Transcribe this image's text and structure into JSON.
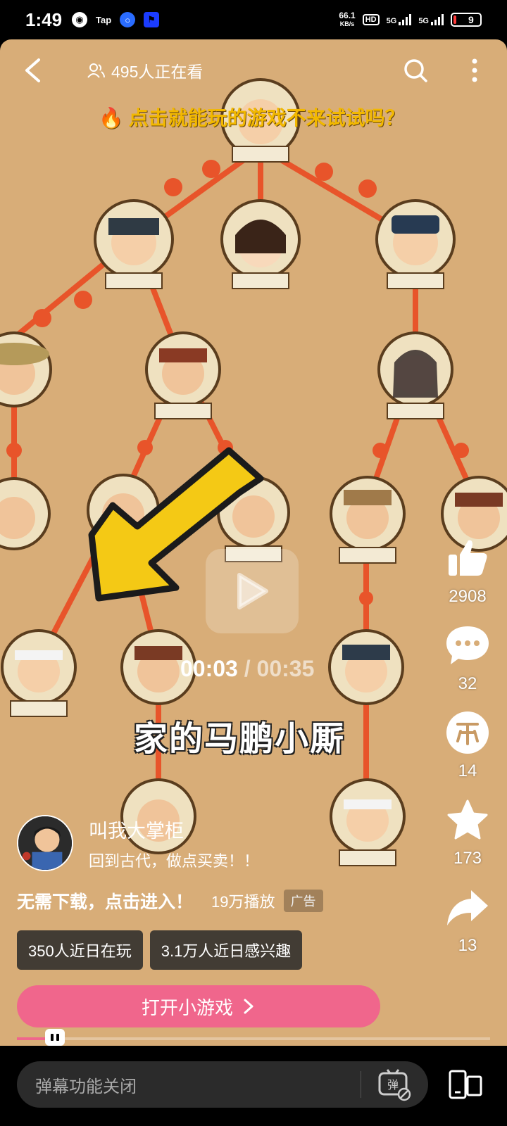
{
  "status_bar": {
    "time": "1:49",
    "net_speed_value": "66.1",
    "net_speed_unit": "KB/s",
    "hd_label": "HD",
    "signal1_label": "5G",
    "signal2_label": "5G",
    "battery_level": "9",
    "app_icons": [
      "location-icon",
      "tap-icon",
      "blue-circle-icon",
      "race-icon"
    ]
  },
  "top_bar": {
    "viewer_count_text": "495人正在看"
  },
  "video": {
    "title": "点击就能玩的游戏不来试试吗？",
    "current_time": "00:03",
    "total_time": "/ 00:35",
    "subtitle": "家的马鹏小厮",
    "progress_fraction": 0.086
  },
  "actions": {
    "like_count": "2908",
    "comment_count": "32",
    "coin_count": "14",
    "favorite_count": "173",
    "share_count": "13"
  },
  "author": {
    "name": "叫我大掌柜",
    "description": "回到古代，做点买卖！！"
  },
  "promo": {
    "cta_text": "无需下载，点击进入！",
    "plays": "19万播放",
    "ad_label": "广告",
    "chips": [
      "350人近日在玩",
      "3.1万人近日感兴趣"
    ],
    "open_button": "打开小游戏"
  },
  "bottom": {
    "danmu_placeholder": "弹幕功能关闭"
  },
  "colors": {
    "accent_pink": "#f0668c",
    "video_bg": "#d8ad78",
    "title_gold": "#f2b800"
  }
}
